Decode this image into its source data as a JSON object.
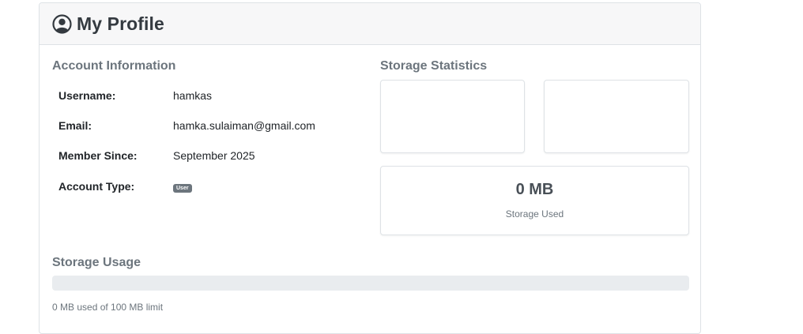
{
  "header": {
    "title": "My Profile",
    "icon": "user-circle-icon"
  },
  "account": {
    "section_title": "Account Information",
    "username_label": "Username:",
    "username_value": "hamkas",
    "email_label": "Email:",
    "email_value": "hamka.sulaiman@gmail.com",
    "member_since_label": "Member Since:",
    "member_since_value": "September 2025",
    "account_type_label": "Account Type:",
    "account_type_badge": "User"
  },
  "stats": {
    "section_title": "Storage Statistics",
    "storage_used_value": "0 MB",
    "storage_used_label": "Storage Used"
  },
  "usage": {
    "section_title": "Storage Usage",
    "progress_fraction": 0,
    "summary": "0 MB used of 100 MB limit"
  },
  "colors": {
    "header_bg": "#f7f7f8",
    "border": "#dee2e6",
    "muted_text": "#6c757d",
    "badge_bg": "#6c757d",
    "progress_track": "#e9ecef"
  }
}
